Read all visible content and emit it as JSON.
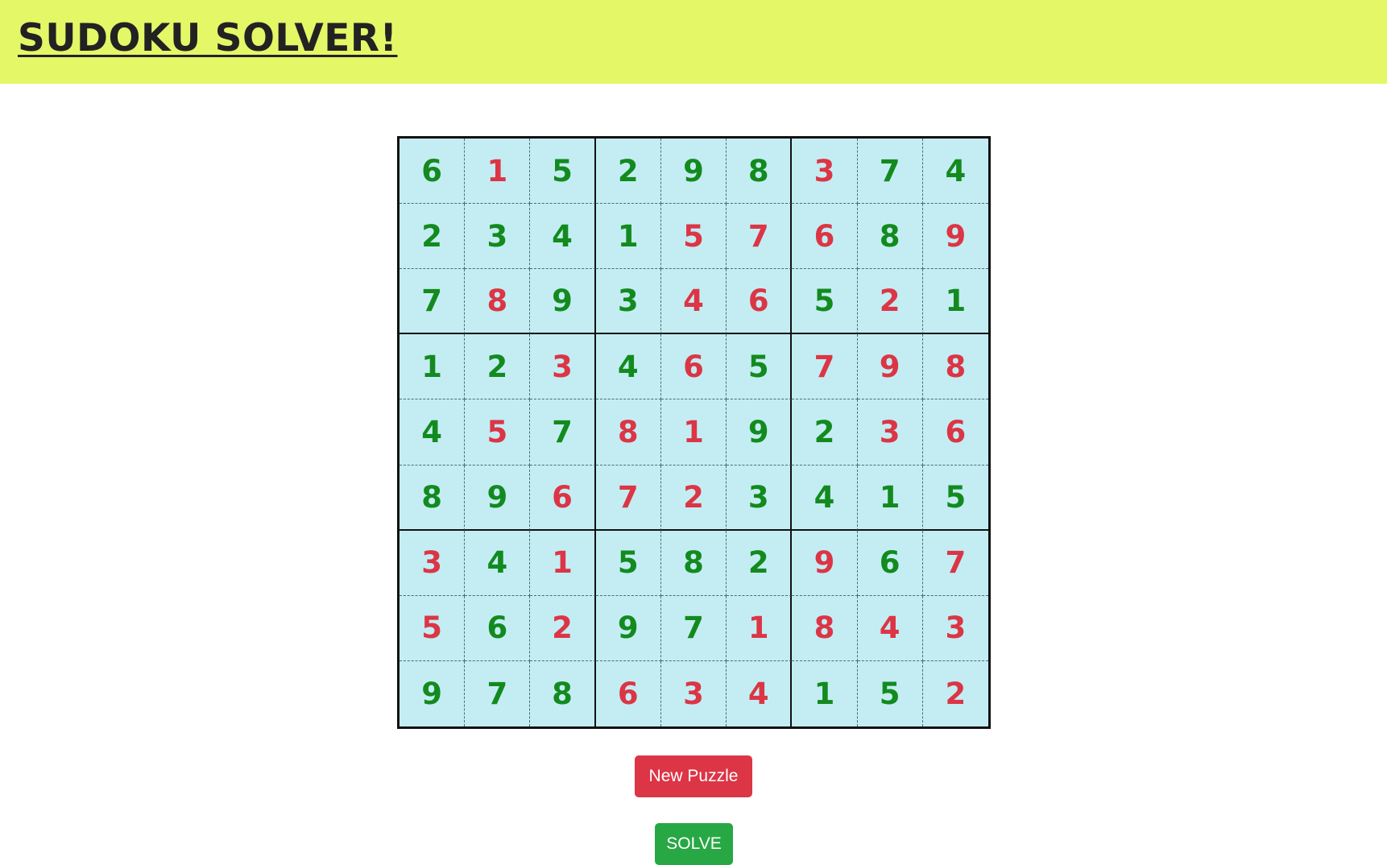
{
  "header": {
    "title": "SUDOKU SOLVER!"
  },
  "colors": {
    "header_bg": "#e4f767",
    "cell_bg": "#c3edf3",
    "given": "#138a1e",
    "solved": "#dc3545",
    "new_puzzle_bg": "#dc3545",
    "solve_bg": "#28a745"
  },
  "board": {
    "cells": [
      [
        "6",
        "1",
        "5",
        "2",
        "9",
        "8",
        "3",
        "7",
        "4"
      ],
      [
        "2",
        "3",
        "4",
        "1",
        "5",
        "7",
        "6",
        "8",
        "9"
      ],
      [
        "7",
        "8",
        "9",
        "3",
        "4",
        "6",
        "5",
        "2",
        "1"
      ],
      [
        "1",
        "2",
        "3",
        "4",
        "6",
        "5",
        "7",
        "9",
        "8"
      ],
      [
        "4",
        "5",
        "7",
        "8",
        "1",
        "9",
        "2",
        "3",
        "6"
      ],
      [
        "8",
        "9",
        "6",
        "7",
        "2",
        "3",
        "4",
        "1",
        "5"
      ],
      [
        "3",
        "4",
        "1",
        "5",
        "8",
        "2",
        "9",
        "6",
        "7"
      ],
      [
        "5",
        "6",
        "2",
        "9",
        "7",
        "1",
        "8",
        "4",
        "3"
      ],
      [
        "9",
        "7",
        "8",
        "6",
        "3",
        "4",
        "1",
        "5",
        "2"
      ]
    ],
    "given": [
      [
        1,
        0,
        1,
        1,
        1,
        1,
        0,
        1,
        1
      ],
      [
        1,
        1,
        1,
        1,
        0,
        0,
        0,
        1,
        0
      ],
      [
        1,
        0,
        1,
        1,
        0,
        0,
        1,
        0,
        1
      ],
      [
        1,
        1,
        0,
        1,
        0,
        1,
        0,
        0,
        0
      ],
      [
        1,
        0,
        1,
        0,
        0,
        1,
        1,
        0,
        0
      ],
      [
        1,
        1,
        0,
        0,
        0,
        1,
        1,
        1,
        1
      ],
      [
        0,
        1,
        0,
        1,
        1,
        1,
        0,
        1,
        0
      ],
      [
        0,
        1,
        0,
        1,
        1,
        0,
        0,
        0,
        0
      ],
      [
        1,
        1,
        1,
        0,
        0,
        0,
        1,
        1,
        0
      ]
    ]
  },
  "buttons": {
    "new_puzzle": "New Puzzle",
    "solve": "SOLVE"
  }
}
